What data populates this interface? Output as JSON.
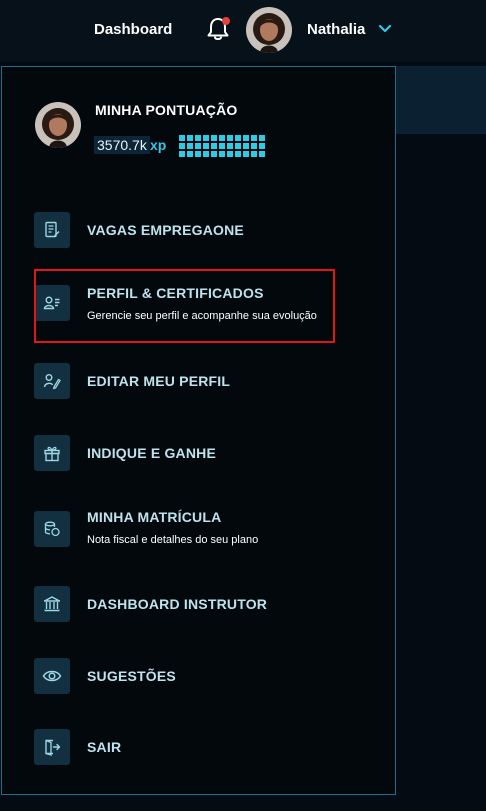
{
  "topbar": {
    "dashboard_label": "Dashboard",
    "username": "Nathalia",
    "notification_dot_color": "#e0433c",
    "accent_color": "#30c9e8"
  },
  "dropdown": {
    "score_title": "MINHA PONTUAÇÃO",
    "xp_value": "3570.7k",
    "xp_unit": "xp",
    "items": [
      {
        "label": "VAGAS EMPREGAONE",
        "subtitle": "",
        "icon": "document-edit-icon"
      },
      {
        "label": "PERFIL & CERTIFICADOS",
        "subtitle": "Gerencie seu perfil e acompanhe sua evolução",
        "icon": "user-list-icon",
        "highlighted": true
      },
      {
        "label": "EDITAR MEU PERFIL",
        "subtitle": "",
        "icon": "user-edit-icon"
      },
      {
        "label": "INDIQUE E GANHE",
        "subtitle": "",
        "icon": "gift-icon"
      },
      {
        "label": "MINHA MATRÍCULA",
        "subtitle": "Nota fiscal e detalhes do seu plano",
        "icon": "coins-icon"
      },
      {
        "label": "DASHBOARD INSTRUTOR",
        "subtitle": "",
        "icon": "bank-icon"
      },
      {
        "label": "SUGESTÕES",
        "subtitle": "",
        "icon": "eye-icon"
      },
      {
        "label": "SAIR",
        "subtitle": "",
        "icon": "logout-icon"
      }
    ],
    "highlight_color": "#e0161a"
  }
}
